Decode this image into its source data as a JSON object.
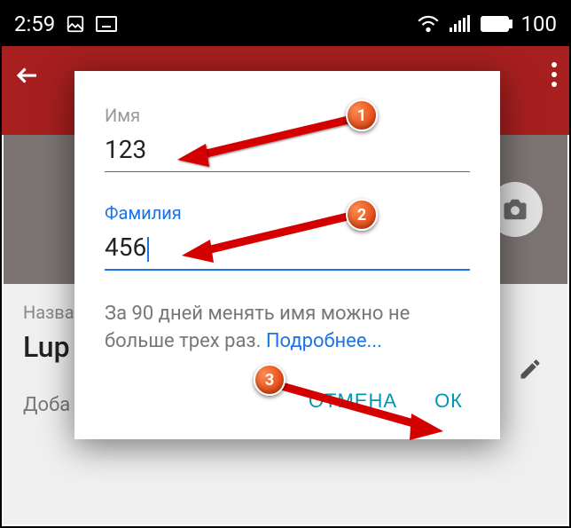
{
  "status": {
    "time": "2:59",
    "battery": "100"
  },
  "background": {
    "label": "Название",
    "name": "Lup",
    "add": "Доба"
  },
  "dialog": {
    "field1_label": "Имя",
    "field1_value": "123",
    "field2_label": "Фамилия",
    "field2_value": "456",
    "info_text": "За 90 дней менять имя можно не больше трех раз. ",
    "info_link": "Подробнее...",
    "cancel": "ОТМЕНА",
    "ok": "ОК"
  },
  "markers": {
    "m1": "1",
    "m2": "2",
    "m3": "3"
  }
}
